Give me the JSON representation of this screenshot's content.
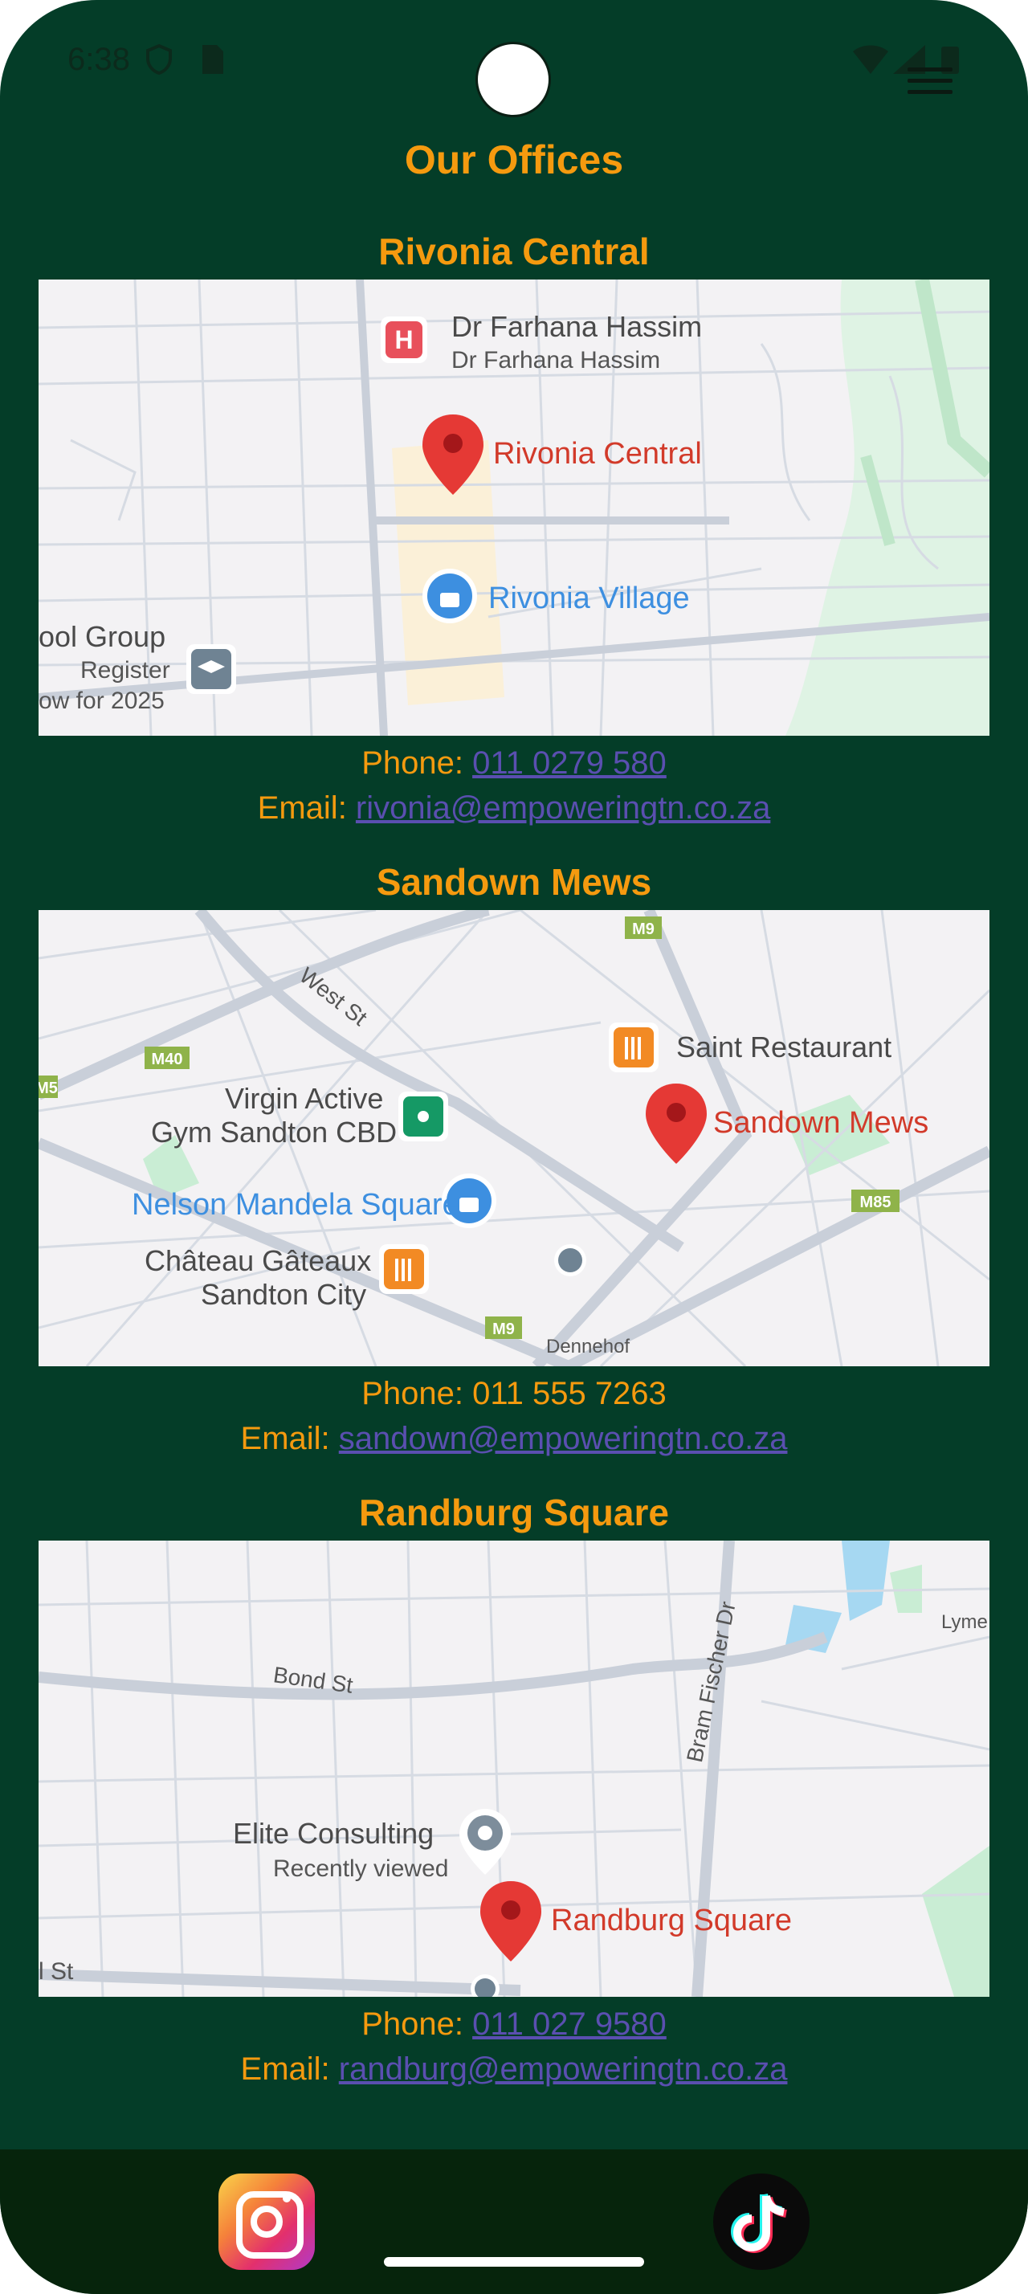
{
  "status_bar": {
    "time": "6:38"
  },
  "page": {
    "title": "Our Offices"
  },
  "offices": [
    {
      "name": "Rivonia Central",
      "phone_label": "Phone: ",
      "phone": "011 0279 580",
      "email_label": "Email: ",
      "email": "rivonia@empoweringtn.co.za",
      "map": {
        "pin_label": "Rivonia Central",
        "labels": [
          "Dr Farhana Hassim",
          "Dr Farhana Hassim",
          "Rivonia Village",
          "ool Group",
          "Register",
          "ow for 2025"
        ]
      }
    },
    {
      "name": "Sandown Mews",
      "phone_label": "Phone: ",
      "phone": "011 555 7263",
      "email_label": "Email: ",
      "email": "sandown@empoweringtn.co.za",
      "map": {
        "pin_label": "Sandown Mews",
        "labels": [
          "West St",
          "Saint Restaurant",
          "Virgin Active",
          "Gym Sandton CBD",
          "Nelson Mandela Square",
          "Château Gâteaux",
          "Sandton City",
          "Dennehof",
          "M9",
          "M40",
          "M85",
          "M9",
          "M5"
        ]
      }
    },
    {
      "name": "Randburg Square",
      "phone_label": "Phone: ",
      "phone": "011 027 9580",
      "email_label": "Email: ",
      "email": "randburg@empoweringtn.co.za",
      "map": {
        "pin_label": "Randburg Square",
        "labels": [
          "Bond St",
          "Bram Fischer Dr",
          "Elite Consulting",
          "Recently viewed",
          "Lyme",
          "l St"
        ]
      }
    }
  ],
  "footer": {
    "icons": [
      "instagram-icon",
      "tiktok-icon"
    ]
  },
  "colors": {
    "background": "#043d28",
    "accent": "#f59a0f",
    "link": "#5a4fb0",
    "footer": "#06240c",
    "pin": "#e53935"
  }
}
